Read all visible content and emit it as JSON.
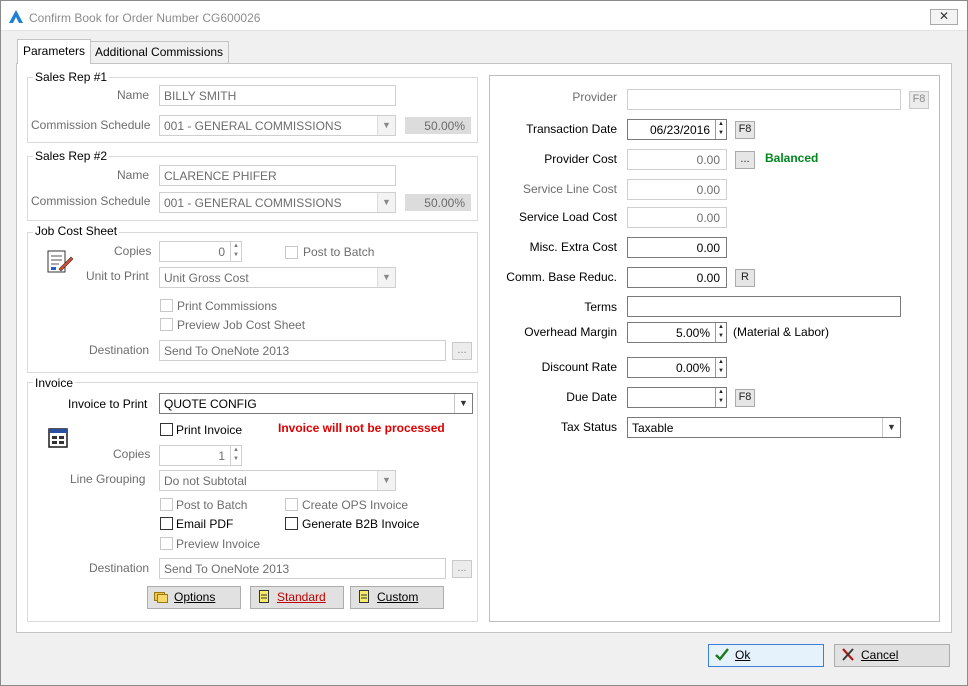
{
  "window": {
    "title": "Confirm Book for Order Number CG600026",
    "close_label": "✕"
  },
  "tabs": [
    "Parameters",
    "Additional Commissions"
  ],
  "sales_rep_1": {
    "title": "Sales Rep #1",
    "name_label": "Name",
    "name_value": "BILLY SMITH",
    "schedule_label": "Commission Schedule",
    "schedule_value": "001 - GENERAL COMMISSIONS",
    "percent": "50.00%"
  },
  "sales_rep_2": {
    "title": "Sales Rep #2",
    "name_label": "Name",
    "name_value": "CLARENCE PHIFER",
    "schedule_label": "Commission Schedule",
    "schedule_value": "001 - GENERAL COMMISSIONS",
    "percent": "50.00%"
  },
  "job_cost": {
    "title": "Job Cost Sheet",
    "copies_label": "Copies",
    "copies_value": "0",
    "post_to_batch": "Post to Batch",
    "unit_label": "Unit to Print",
    "unit_value": "Unit Gross Cost",
    "print_commissions": "Print Commissions",
    "preview": "Preview Job Cost Sheet",
    "destination_label": "Destination",
    "destination_value": "Send To OneNote 2013",
    "browse": "..."
  },
  "invoice": {
    "title": "Invoice",
    "invoice_to_print_label": "Invoice to Print",
    "invoice_to_print_value": "QUOTE CONFIG",
    "print_invoice": "Print Invoice",
    "warning": "Invoice will not be processed",
    "copies_label": "Copies",
    "copies_value": "1",
    "grouping_label": "Line Grouping",
    "grouping_value": "Do not Subtotal",
    "post_to_batch": "Post to Batch",
    "create_ops": "Create OPS Invoice",
    "email_pdf": "Email PDF",
    "generate_b2b": "Generate B2B Invoice",
    "preview": "Preview Invoice",
    "destination_label": "Destination",
    "destination_value": "Send To OneNote 2013",
    "browse": "...",
    "options_btn": "Options",
    "standard_btn": "Standard",
    "custom_btn": "Custom"
  },
  "right": {
    "provider_label": "Provider",
    "provider_value": "",
    "provider_f8": "F8",
    "trans_date_label": "Transaction Date",
    "trans_date_value": "06/23/2016",
    "trans_date_f8": "F8",
    "provider_cost_label": "Provider Cost",
    "provider_cost_value": "0.00",
    "provider_cost_btn": "...",
    "balanced": "Balanced",
    "service_line_label": "Service Line Cost",
    "service_line_value": "0.00",
    "service_load_label": "Service Load Cost",
    "service_load_value": "0.00",
    "misc_label": "Misc. Extra Cost",
    "misc_value": "0.00",
    "comm_base_label": "Comm. Base Reduc.",
    "comm_base_value": "0.00",
    "comm_base_btn": "R",
    "terms_label": "Terms",
    "terms_value": "",
    "overhead_label": "Overhead Margin",
    "overhead_value": "5.00%",
    "overhead_note": "(Material & Labor)",
    "discount_label": "Discount Rate",
    "discount_value": "0.00%",
    "due_label": "Due Date",
    "due_value": "",
    "due_f8": "F8",
    "tax_label": "Tax Status",
    "tax_value": "Taxable"
  },
  "footer": {
    "ok": "Ok",
    "cancel": "Cancel"
  },
  "colors": {
    "warning": "#e00000",
    "balanced": "#00861e"
  }
}
